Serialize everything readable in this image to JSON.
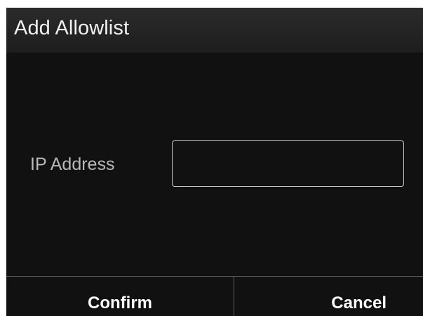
{
  "dialog": {
    "title": "Add Allowlist",
    "ip_field": {
      "label": "IP Address",
      "value": "",
      "placeholder": ""
    },
    "buttons": {
      "confirm": "Confirm",
      "cancel": "Cancel"
    }
  },
  "colors": {
    "background": "#111111",
    "title_bar": "#242424",
    "text": "#ffffff",
    "label_text": "#b9b9b9",
    "input_border": "#c8c8c8",
    "divider": "#5e5e5e"
  }
}
